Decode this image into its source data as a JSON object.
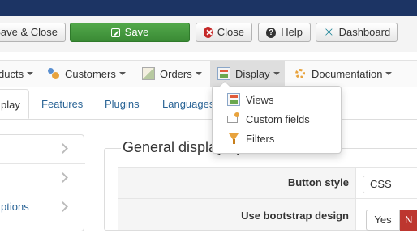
{
  "toolbar": {
    "save_close_label": "Save & Close",
    "save_label": "Save",
    "close_label": "Close",
    "help_label": "Help",
    "dashboard_label": "Dashboard"
  },
  "menubar": {
    "items": [
      {
        "label": "ducts",
        "icon": "products-icon"
      },
      {
        "label": "Customers",
        "icon": "customers-icon"
      },
      {
        "label": "Orders",
        "icon": "orders-icon"
      },
      {
        "label": "Display",
        "icon": "display-icon",
        "active": true
      },
      {
        "label": "Documentation",
        "icon": "documentation-icon"
      }
    ]
  },
  "display_menu": {
    "items": [
      {
        "label": "Views",
        "icon": "views-icon"
      },
      {
        "label": "Custom fields",
        "icon": "custom-fields-icon"
      },
      {
        "label": "Filters",
        "icon": "filters-icon"
      }
    ]
  },
  "tabs": [
    {
      "label": "play",
      "active": true
    },
    {
      "label": "Features"
    },
    {
      "label": "Plugins"
    },
    {
      "label": "Languages"
    }
  ],
  "sidebar": {
    "items": [
      {
        "label": ""
      },
      {
        "label": ""
      },
      {
        "label": "ptions"
      }
    ]
  },
  "main": {
    "section_title": "General display options",
    "fields": [
      {
        "label": "Button style",
        "value": "CSS"
      },
      {
        "label": "Use bootstrap design",
        "yes": "Yes",
        "no": "N"
      }
    ]
  },
  "colors": {
    "topbar": "#1c3464",
    "save_button": "#46a040",
    "close_icon": "#c52827",
    "link": "#2a6496",
    "toggle_no": "#bd362f"
  }
}
